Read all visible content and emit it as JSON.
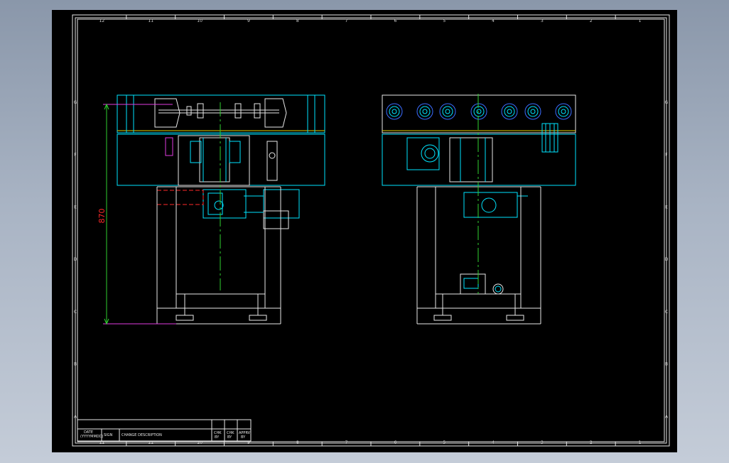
{
  "dimension": {
    "height_value": "870"
  },
  "title_block": {
    "date_label": "DATE",
    "date_value": "(YYYYMMDD)",
    "sign_label": "SIGN",
    "change_description": "CHANGE DESCRIPTION",
    "check_label": "CHK",
    "check_by": "BY",
    "chk_label": "CHK",
    "chk_by": "BY",
    "apprv_label": "APPRV",
    "apprv_by": "BY"
  },
  "border_ticks": {
    "columns": [
      "12",
      "11",
      "10",
      "9",
      "8",
      "7",
      "6",
      "5",
      "4",
      "3",
      "2",
      "1"
    ],
    "rows": [
      "G",
      "F",
      "E",
      "D",
      "C",
      "B",
      "A"
    ]
  },
  "colors": {
    "line_white": "#e8e8e8",
    "line_cyan": "#00e5ff",
    "line_green": "#2fd12f",
    "line_magenta": "#e03ce0",
    "line_red": "#ff2a2a",
    "background": "#000000"
  }
}
